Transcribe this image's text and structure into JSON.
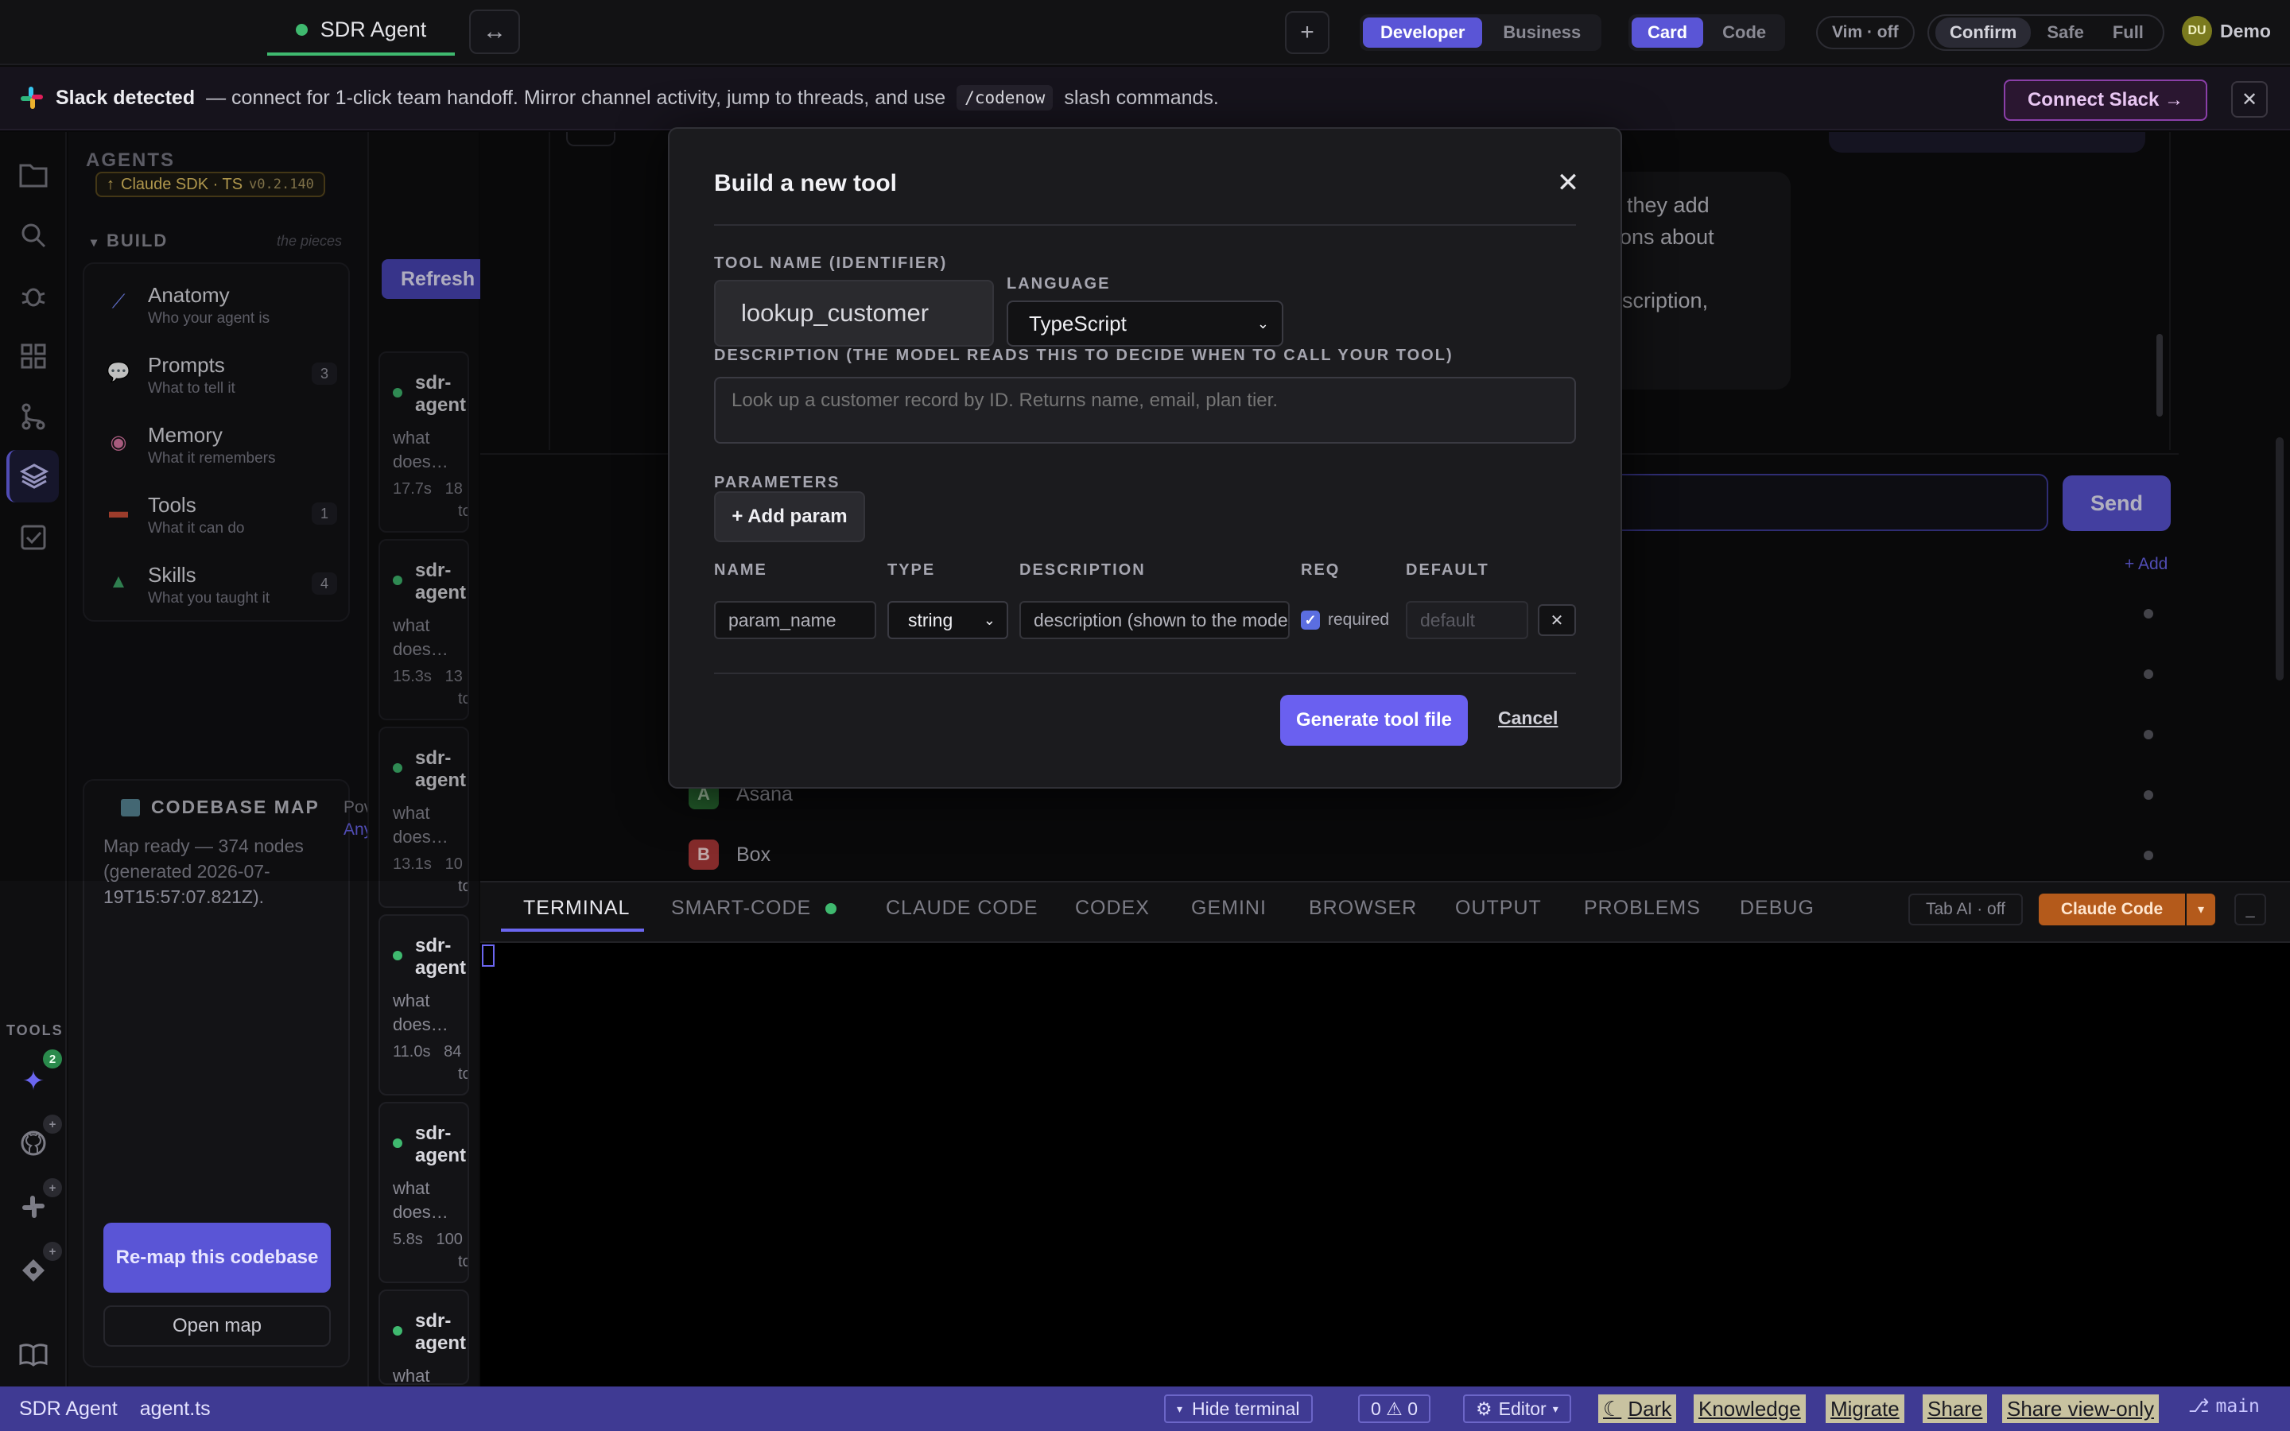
{
  "topbar": {
    "active_tab": "SDR Agent",
    "swap_icon": "↔",
    "plus_icon": "+",
    "mode_tabs": [
      "Developer",
      "Business"
    ],
    "mode_active": "Developer",
    "view_tabs": [
      "Card",
      "Code"
    ],
    "view_active": "Card",
    "vim": "Vim · off",
    "perm_tabs": [
      "Confirm",
      "Safe",
      "Full"
    ],
    "user_initials": "DU",
    "user_name": "Demo"
  },
  "banner": {
    "title": "Slack detected",
    "text_before": "— connect for 1-click team handoff. Mirror channel activity, jump to threads, and use",
    "command": "/codenow",
    "text_after": "slash commands.",
    "connect_label": "Connect Slack →",
    "close_label": "✕"
  },
  "activity": {
    "tools_label": "TOOLS",
    "badge_count": "2"
  },
  "sidebar": {
    "title": "AGENTS",
    "sdk_arrow": "↑",
    "sdk_name": "Claude SDK · TS",
    "sdk_version": "v0.2.140",
    "build_title": "BUILD",
    "build_subtitle": "the pieces",
    "items": [
      {
        "icon": "anatomy-icon",
        "name": "Anatomy",
        "sub": "Who your agent is",
        "count": ""
      },
      {
        "icon": "prompts-icon",
        "name": "Prompts",
        "sub": "What to tell it",
        "count": "3"
      },
      {
        "icon": "memory-icon",
        "name": "Memory",
        "sub": "What it remembers",
        "count": ""
      },
      {
        "icon": "tools-icon",
        "name": "Tools",
        "sub": "What it can do",
        "count": "1"
      },
      {
        "icon": "skills-icon",
        "name": "Skills",
        "sub": "What you taught it",
        "count": "4"
      }
    ],
    "codebase_title": "CODEBASE MAP",
    "codebase_text": "Map ready — 374 nodes (generated 2026-07-19T15:57:07.821Z).",
    "remap_label": "Re-map this codebase",
    "openmap_label": "Open map",
    "pow_text": "Pov",
    "any_text": "Any"
  },
  "runs": {
    "refresh_label": "Refresh",
    "items": [
      {
        "name": "sdr-agent",
        "q": "what does…",
        "time": "17.7s",
        "tok": "18",
        "tok2": "tok"
      },
      {
        "name": "sdr-agent",
        "q": "what does…",
        "time": "15.3s",
        "tok": "13",
        "tok2": "tok"
      },
      {
        "name": "sdr-agent",
        "q": "what does…",
        "time": "13.1s",
        "tok": "10",
        "tok2": "tok"
      },
      {
        "name": "sdr-agent",
        "q": "what does…",
        "time": "11.0s",
        "tok": "84",
        "tok2": "tok"
      },
      {
        "name": "sdr-agent",
        "q": "what does…",
        "time": "5.8s",
        "tok": "100",
        "tok2": "tok"
      },
      {
        "name": "sdr-agent",
        "q": "what",
        "time": "",
        "tok": "",
        "tok2": ""
      }
    ]
  },
  "chat": {
    "bubble_lines": [
      "ce they add",
      "stions about",
      "",
      "description,"
    ],
    "send_label": "Send",
    "add_label": "+ Add",
    "integrations": [
      {
        "letter": "A",
        "name": "Asana",
        "color": "#2f7d3a"
      },
      {
        "letter": "B",
        "name": "Box",
        "color": "#b23a3a"
      }
    ]
  },
  "modal": {
    "title": "Build a new tool",
    "close_label": "✕",
    "tool_name_label": "TOOL NAME (IDENTIFIER)",
    "tool_name_value": "lookup_customer",
    "language_label": "LANGUAGE",
    "language_value": "TypeScript",
    "description_label": "DESCRIPTION (THE MODEL READS THIS TO DECIDE WHEN TO CALL YOUR TOOL)",
    "description_placeholder": "Look up a customer record by ID. Returns name, email, plan tier.",
    "parameters_label": "PARAMETERS",
    "add_param_label": "+ Add param",
    "columns": [
      "NAME",
      "TYPE",
      "DESCRIPTION",
      "REQ",
      "DEFAULT"
    ],
    "param": {
      "name_placeholder": "param_name",
      "type_value": "string",
      "desc_placeholder": "description (shown to the model)",
      "required_label": "required",
      "default_placeholder": "default",
      "remove_label": "✕"
    },
    "generate_label": "Generate tool file",
    "cancel_label": "Cancel"
  },
  "terminal": {
    "tabs": [
      "TERMINAL",
      "SMART-CODE",
      "CLAUDE CODE",
      "CODEX",
      "GEMINI",
      "BROWSER",
      "OUTPUT",
      "PROBLEMS",
      "DEBUG"
    ],
    "active": "TERMINAL",
    "tab_ai": "Tab AI · off",
    "claude_code_label": "Claude Code",
    "dropdown_icon": "▾",
    "minimize_icon": "_"
  },
  "status": {
    "app": "SDR Agent",
    "file": "agent.ts",
    "hide_terminal": "Hide terminal",
    "problems": "0 ⚠ 0",
    "editor": "Editor",
    "dark": "Dark",
    "knowledge": "Knowledge",
    "migrate": "Migrate",
    "share": "Share",
    "share_view": "Share view-only",
    "branch": "main"
  },
  "colors": {
    "accent": "#5a55d6",
    "success": "#3fb96f",
    "claude": "#b45a1b"
  }
}
